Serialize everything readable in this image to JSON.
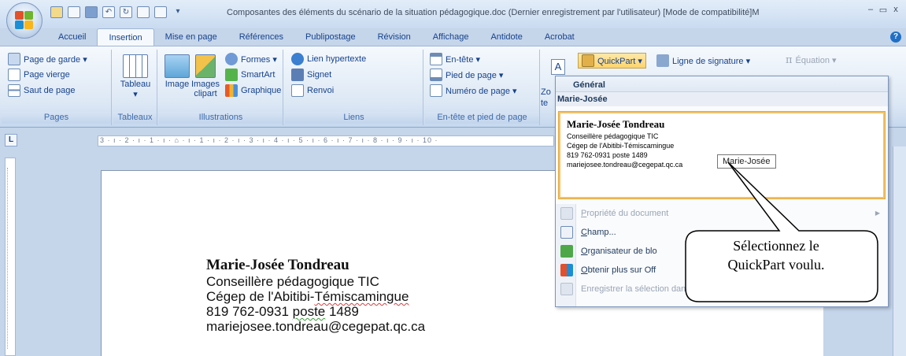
{
  "window": {
    "title": "Composantes des éléments du scénario de la situation pédagogique.doc (Dernier enregistrement par l'utilisateur) [Mode de compatibilité]M",
    "controls": [
      "–",
      "▭",
      "x"
    ]
  },
  "tabs": [
    "Accueil",
    "Insertion",
    "Mise en page",
    "Références",
    "Publipostage",
    "Révision",
    "Affichage",
    "Antidote",
    "Acrobat"
  ],
  "active_tab": "Insertion",
  "ribbon": {
    "pages": {
      "label": "Pages",
      "items": [
        "Page de garde ▾",
        "Page vierge",
        "Saut de page"
      ]
    },
    "tableaux": {
      "label": "Tableaux",
      "item": "Tableau",
      "arrow": "▾"
    },
    "illustrations": {
      "label": "Illustrations",
      "image": "Image",
      "images_clipart": "Images",
      "clipart2": "clipart",
      "formes": "Formes ▾",
      "smartart": "SmartArt",
      "graphique": "Graphique"
    },
    "liens": {
      "label": "Liens",
      "items": [
        "Lien hypertexte",
        "Signet",
        "Renvoi"
      ]
    },
    "entete": {
      "label": "En-tête et pied de page",
      "items": [
        "En-tête ▾",
        "Pied de page ▾",
        "Numéro de page ▾"
      ]
    },
    "texte": {
      "zone": "Zo",
      "zone2": "te",
      "quickpart": "QuickPart ▾",
      "signature": "Ligne de signature ▾",
      "equation": "Équation ▾"
    }
  },
  "ruler": {
    "text": "3 · ı · 2 · ı · 1 · ı · ⌂ · ı · 1 · ı · 2 · ı · 3 · ı · 4 · ı · 5 · ı · 6 · ı · 7 · ı · 8 · ı · 9 · ı · 10 ·",
    "corner": "L"
  },
  "document": {
    "name": "Marie-Josée Tondreau",
    "line1": "Conseillère pédagogique TIC",
    "line2a": "Cégep de l'Abitibi-",
    "line2b": "Témiscamingue",
    "line3a": "819 762-0931 ",
    "line3b": "poste",
    "line3c": " 1489",
    "line4": "mariejosee.tondreau@cegepat.qc.ca"
  },
  "quickpart_menu": {
    "header": "Général",
    "subheader": "Marie-Josée",
    "preview": {
      "name": "Marie-Josée Tondreau",
      "lines": [
        "Conseillère pédagogique TIC",
        "Cégep de l'Abitibi-Témiscamingue",
        "819 762-0931 poste 1489",
        "mariejosee.tondreau@cegepat.qc.ca"
      ],
      "tooltip": "Marie-Josée"
    },
    "items": [
      {
        "underline": "P",
        "rest": "ropriété du document",
        "disabled": true
      },
      {
        "underline": "C",
        "rest": "hamp...",
        "disabled": false
      },
      {
        "underline": "O",
        "rest": "rganisateur de blo",
        "disabled": false
      },
      {
        "underline": "O",
        "rest": "btenir plus sur Off",
        "disabled": false
      },
      {
        "underline": "",
        "rest": "Enregistrer la sélection dans la galerie de composants QuickPart",
        "disabled": true
      }
    ]
  },
  "callout": {
    "line1": "Sélectionnez le",
    "line2": "QuickPart voulu."
  },
  "help_icon": "?"
}
